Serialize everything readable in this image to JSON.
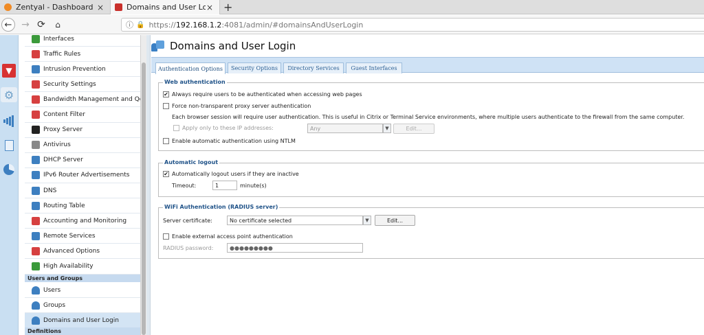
{
  "browser": {
    "tabs": [
      {
        "title": "Zentyal - Dashboard",
        "close": "×"
      },
      {
        "title": "Domains and User Login",
        "close": "×"
      }
    ],
    "new_tab": "+",
    "url": {
      "scheme": "https://",
      "host": "192.168.1.2",
      "rest": ":4081/admin/#domainsAndUserLogin"
    },
    "icons": {
      "back": "←",
      "forward": "→",
      "reload": "⟳",
      "home": "⌂",
      "info": "ⓘ",
      "lock": "🔒"
    }
  },
  "sidebar": {
    "items": [
      {
        "label": "Interfaces",
        "icon_color": "#3b9a3b"
      },
      {
        "label": "Traffic Rules",
        "icon_color": "#d64040"
      },
      {
        "label": "Intrusion Prevention",
        "icon_color": "#3d7fc0"
      },
      {
        "label": "Security Settings",
        "icon_color": "#d64040"
      },
      {
        "label": "Bandwidth Management and QoS",
        "icon_color": "#d64040"
      },
      {
        "label": "Content Filter",
        "icon_color": "#d64040"
      },
      {
        "label": "Proxy Server",
        "icon_color": "#222222"
      },
      {
        "label": "Antivirus",
        "icon_color": "#888888"
      },
      {
        "label": "DHCP Server",
        "icon_color": "#3d7fc0"
      },
      {
        "label": "IPv6 Router Advertisements",
        "icon_color": "#3d7fc0"
      },
      {
        "label": "DNS",
        "icon_color": "#3d7fc0"
      },
      {
        "label": "Routing Table",
        "icon_color": "#3d7fc0"
      },
      {
        "label": "Accounting and Monitoring",
        "icon_color": "#d64040"
      },
      {
        "label": "Remote Services",
        "icon_color": "#3d7fc0"
      },
      {
        "label": "Advanced Options",
        "icon_color": "#d64040"
      },
      {
        "label": "High Availability",
        "icon_color": "#3b9a3b"
      }
    ],
    "section_users": "Users and Groups",
    "users_items": [
      {
        "label": "Users",
        "icon_color": "#3d7fc0"
      },
      {
        "label": "Groups",
        "icon_color": "#3d7fc0"
      },
      {
        "label": "Domains and User Login",
        "icon_color": "#3d7fc0"
      }
    ],
    "section_definitions": "Definitions"
  },
  "main": {
    "title": "Domains and User Login",
    "tabs": [
      {
        "label": "Authentication Options"
      },
      {
        "label": "Security Options"
      },
      {
        "label": "Directory Services"
      },
      {
        "label": "Guest Interfaces"
      }
    ],
    "web_auth": {
      "legend": "Web authentication",
      "always_require": "Always require users to be authenticated when accessing web pages",
      "always_require_checked": "✔",
      "force_nontransparent": "Force non-transparent proxy server authentication",
      "note": "Each browser session will require user authentication. This is useful in Citrix or Terminal Service environments, where multiple users authenticate to the firewall from the same computer.",
      "apply_only": "Apply only to these IP addresses:",
      "ip_select": "Any",
      "edit": "Edit...",
      "ntlm": "Enable automatic authentication using NTLM"
    },
    "auto_logout": {
      "legend": "Automatic logout",
      "auto_logout_label": "Automatically logout users if they are inactive",
      "auto_logout_checked": "✔",
      "timeout_label": "Timeout:",
      "timeout_value": "1",
      "timeout_unit": "minute(s)"
    },
    "wifi": {
      "legend": "WiFi Authentication (RADIUS server)",
      "cert_label": "Server certificate:",
      "cert_value": "No certificate selected",
      "edit": "Edit...",
      "external_ap": "Enable external access point authentication",
      "radius_label": "RADIUS password:",
      "radius_value": "●●●●●●●●●"
    }
  }
}
